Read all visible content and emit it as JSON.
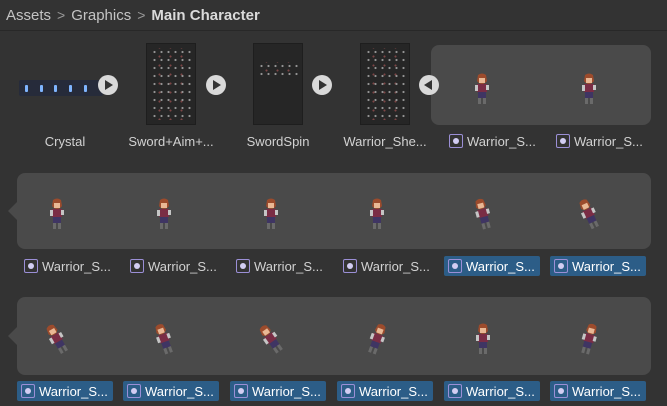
{
  "breadcrumb": {
    "items": [
      "Assets",
      "Graphics"
    ],
    "current": "Main Character",
    "separator": ">"
  },
  "colors": {
    "background": "#333333",
    "band": "#4a4a4a",
    "selection": "#2c5d87",
    "sprite_icon": "#9b8fd6"
  },
  "row1": {
    "assets": [
      {
        "label": "Crystal",
        "kind": "texture-strip",
        "button_icon": "play-icon"
      },
      {
        "label": "Sword+Aim+...",
        "kind": "texture-sheet",
        "button_icon": "play-icon"
      },
      {
        "label": "SwordSpin",
        "kind": "texture-sheet",
        "button_icon": "play-icon"
      },
      {
        "label": "Warrior_She...",
        "kind": "texture-sheet",
        "button_icon": "collapse-icon"
      }
    ],
    "sprites": [
      {
        "label": "Warrior_S...",
        "selected": false
      },
      {
        "label": "Warrior_S...",
        "selected": false
      }
    ]
  },
  "row2": {
    "sprites": [
      {
        "label": "Warrior_S...",
        "selected": false
      },
      {
        "label": "Warrior_S...",
        "selected": false
      },
      {
        "label": "Warrior_S...",
        "selected": false
      },
      {
        "label": "Warrior_S...",
        "selected": false
      },
      {
        "label": "Warrior_S...",
        "selected": true
      },
      {
        "label": "Warrior_S...",
        "selected": true
      }
    ]
  },
  "row3": {
    "sprites": [
      {
        "label": "Warrior_S...",
        "selected": true
      },
      {
        "label": "Warrior_S...",
        "selected": true
      },
      {
        "label": "Warrior_S...",
        "selected": true
      },
      {
        "label": "Warrior_S...",
        "selected": true
      },
      {
        "label": "Warrior_S...",
        "selected": true
      },
      {
        "label": "Warrior_S...",
        "selected": true
      }
    ]
  }
}
